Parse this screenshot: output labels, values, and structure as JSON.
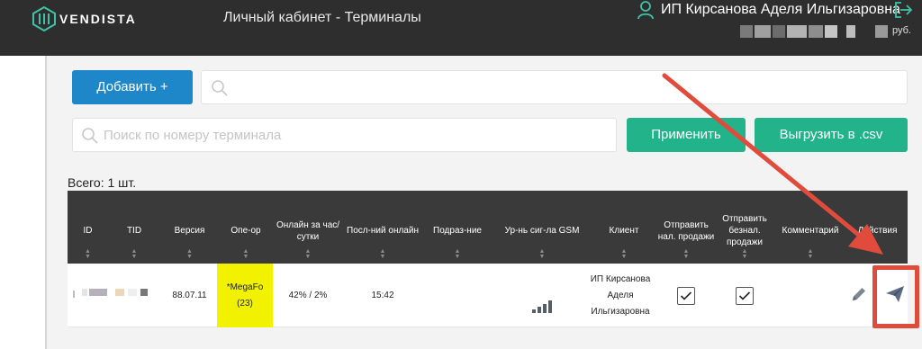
{
  "header": {
    "logo_text": "VENDISTA",
    "page_title": "Личный кабинет - Терминалы",
    "user_name": "ИП Кирсанова Аделя Ильгизаровна",
    "currency": "руб."
  },
  "toolbar": {
    "add_label": "Добавить +",
    "search_placeholder": "Поиск по номеру терминала",
    "apply_label": "Применить",
    "export_label": "Выгрузить в .csv"
  },
  "table": {
    "total": "Всего: 1 шт.",
    "columns": [
      "ID",
      "TID",
      "Версия",
      "Опе-ор",
      "Онлайн за час/ сутки",
      "Посл-ний онлайн",
      "Подраз-ние",
      "Ур-нь сиг-ла GSM",
      "Клиент",
      "Отправить нал. продажи",
      "Отправить безнал. продажи",
      "Комментарий",
      "Действия"
    ],
    "rows": [
      {
        "version": "88.07.11",
        "operator": "*MegaFo",
        "operator_count": "(23)",
        "online": "42% / 2%",
        "last_online": "15:42",
        "client": "ИП Кирсанова Аделя Ильгизаровна",
        "send_cash": true,
        "send_cashless": true,
        "gsm_level": 4
      }
    ]
  },
  "colors": {
    "topbar": "#2e2e2e",
    "primary": "#1e87c9",
    "success": "#22b38a",
    "table_header": "#3a3a3a",
    "operator_highlight": "#f2f200",
    "annotation": "#e04b3c"
  },
  "icons": {
    "logo": "vendista-logo-icon",
    "user": "user-icon",
    "logout": "logout-icon",
    "search": "search-icon",
    "edit": "pencil-icon",
    "send": "paper-plane-icon"
  }
}
